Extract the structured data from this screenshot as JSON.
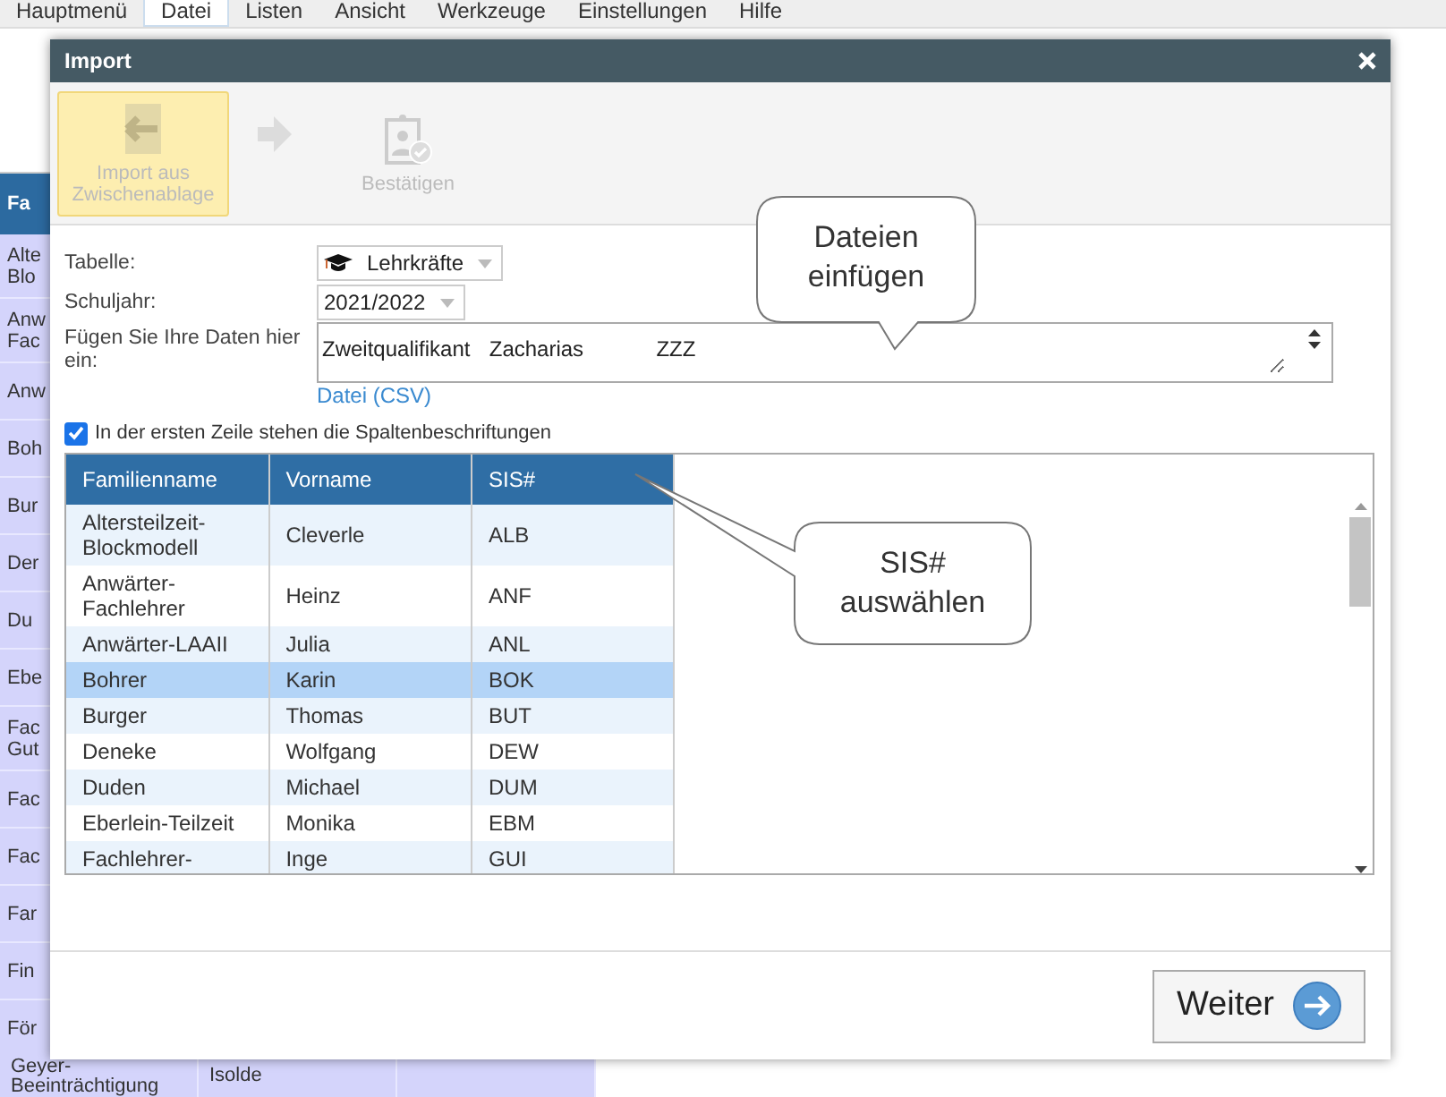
{
  "menu": [
    {
      "label": "Hauptmenü",
      "selected": false
    },
    {
      "label": "Datei",
      "selected": true
    },
    {
      "label": "Listen",
      "selected": false
    },
    {
      "label": "Ansicht",
      "selected": false
    },
    {
      "label": "Werkzeuge",
      "selected": false
    },
    {
      "label": "Einstellungen",
      "selected": false
    },
    {
      "label": "Hilfe",
      "selected": false
    }
  ],
  "background": {
    "header": "Fa",
    "items": [
      [
        "Alte",
        "Blo"
      ],
      [
        "Anw",
        "Fac"
      ],
      [
        "Anw"
      ],
      [
        "Boh"
      ],
      [
        "Bur"
      ],
      [
        "Der"
      ],
      [
        "Du"
      ],
      [
        "Ebe"
      ],
      [
        "Fac",
        "Gut"
      ],
      [
        "Fac"
      ],
      [
        "Fac"
      ],
      [
        "Far"
      ],
      [
        "Fin"
      ],
      [
        "För"
      ]
    ],
    "bottom_row": [
      "Geyer-Beeinträchtigung",
      "Isolde"
    ]
  },
  "dialog": {
    "title": "Import",
    "steps": [
      {
        "kind": "clipboard",
        "label": "Import aus Zwischenablage",
        "active": true
      },
      {
        "kind": "arrow"
      },
      {
        "kind": "confirm",
        "label": "Bestätigen",
        "active": false
      }
    ],
    "form": {
      "table_label": "Tabelle:",
      "table_value": "Lehrkräfte",
      "year_label": "Schuljahr:",
      "year_value": "2021/2022",
      "data_label": "Fügen Sie Ihre Daten hier ein:",
      "data_value": "Zweitqualifikant\tZacharias\tZZZ",
      "csv_link": "Datei (CSV)",
      "header_checkbox": {
        "label": "In der ersten Zeile stehen die Spaltenbeschriftungen",
        "checked": true
      }
    },
    "table": {
      "columns": [
        "Familienname",
        "Vorname",
        "SIS#"
      ],
      "rows": [
        {
          "cells": [
            "Altersteilzeit-Blockmodell",
            "Cleverle",
            "ALB"
          ],
          "selected": false
        },
        {
          "cells": [
            "Anwärter-Fachlehrer",
            "Heinz",
            "ANF"
          ],
          "selected": false
        },
        {
          "cells": [
            "Anwärter-LAAII",
            "Julia",
            "ANL"
          ],
          "selected": false
        },
        {
          "cells": [
            "Bohrer",
            "Karin",
            "BOK"
          ],
          "selected": true
        },
        {
          "cells": [
            "Burger",
            "Thomas",
            "BUT"
          ],
          "selected": false
        },
        {
          "cells": [
            "Deneke",
            "Wolfgang",
            "DEW"
          ],
          "selected": false
        },
        {
          "cells": [
            "Duden",
            "Michael",
            "DUM"
          ],
          "selected": false
        },
        {
          "cells": [
            "Eberlein-Teilzeit",
            "Monika",
            "EBM"
          ],
          "selected": false
        },
        {
          "cells": [
            "Fachlehrer-",
            "Inge",
            "GUI"
          ],
          "selected": false
        }
      ]
    },
    "next_button": "Weiter"
  },
  "callouts": [
    {
      "kind": "down",
      "text": "Dateien einfügen"
    },
    {
      "kind": "left",
      "text": "SIS# auswählen"
    }
  ]
}
